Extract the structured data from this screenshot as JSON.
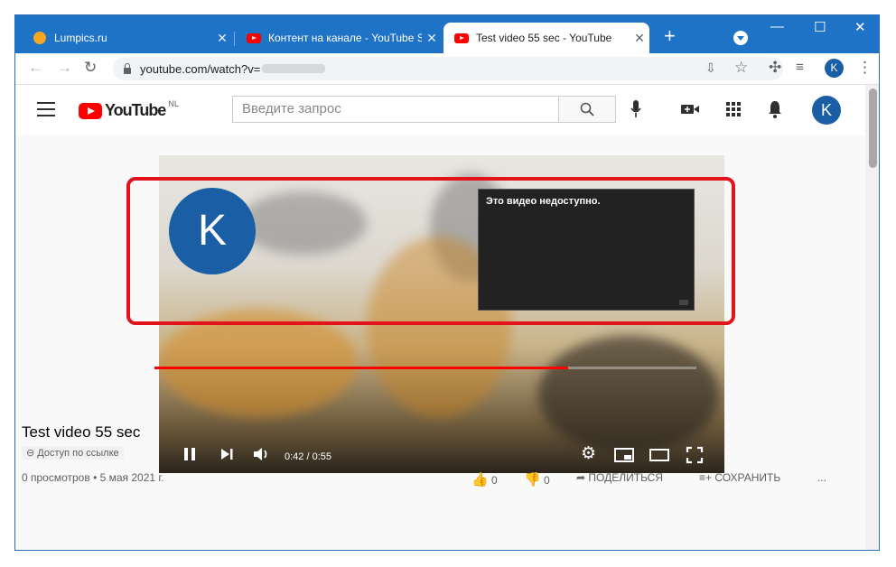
{
  "tabs": [
    {
      "title": "Lumpics.ru",
      "favicon": "orange-circle-icon",
      "active": false
    },
    {
      "title": "Контент на канале - YouTube S",
      "favicon": "youtube-icon",
      "active": false
    },
    {
      "title": "Test video 55 sec - YouTube",
      "favicon": "youtube-icon",
      "active": true
    }
  ],
  "window_controls": {
    "minimize": "—",
    "maximize": "☐",
    "close": "✕"
  },
  "address_bar": {
    "url": "youtube.com/watch?v=",
    "profile_letter": "K"
  },
  "youtube": {
    "logo_text": "YouTube",
    "region": "NL",
    "search_placeholder": "Введите запрос",
    "avatar_letter": "K"
  },
  "player": {
    "annotation_letter": "K",
    "unavailable_message": "Это видео недоступно.",
    "time": "0:42 / 0:55",
    "progress": 0.764
  },
  "video": {
    "title": "Test video 55 sec",
    "access": "Доступ по ссылке",
    "stats": "0 просмотров • 5 мая 2021 г.",
    "likes": "0",
    "dislikes": "0",
    "share_label": "ПОДЕЛИТЬСЯ",
    "save_label": "СОХРАНИТЬ",
    "more_label": "..."
  },
  "colors": {
    "titlebar": "#1f73c6",
    "accent_red": "#ff0000",
    "avatar_blue": "#1a5fa6",
    "highlight_frame": "#e2131b"
  }
}
